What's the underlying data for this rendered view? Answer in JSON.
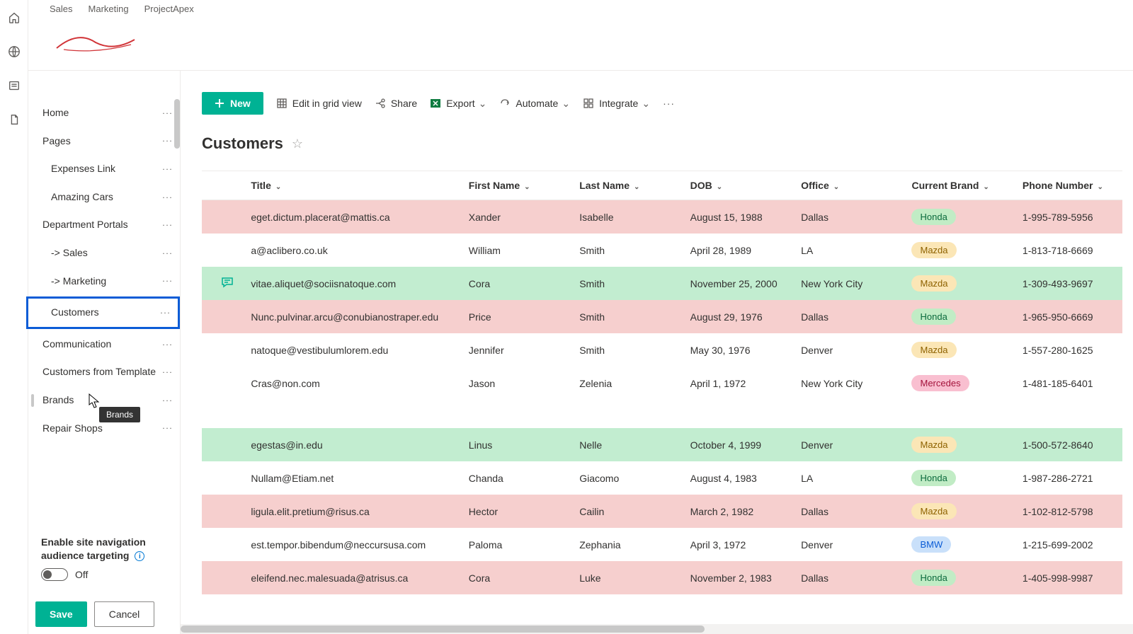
{
  "tabs": [
    "Sales",
    "Marketing",
    "ProjectApex"
  ],
  "sidebar": {
    "items": [
      {
        "label": "Home"
      },
      {
        "label": "Pages"
      },
      {
        "label": "Expenses Link"
      },
      {
        "label": "Amazing Cars"
      },
      {
        "label": "Department Portals"
      },
      {
        "label": "-> Sales"
      },
      {
        "label": "-> Marketing"
      },
      {
        "label": "Customers"
      },
      {
        "label": "Communication"
      },
      {
        "label": "Customers from Template"
      },
      {
        "label": "Brands"
      },
      {
        "label": "Repair Shops"
      }
    ],
    "tooltip": "Brands",
    "audience_targeting_title": "Enable site navigation audience targeting",
    "toggle_label": "Off",
    "save": "Save",
    "cancel": "Cancel"
  },
  "toolbar": {
    "new": "New",
    "edit": "Edit in grid view",
    "share": "Share",
    "export": "Export",
    "automate": "Automate",
    "integrate": "Integrate"
  },
  "page_title": "Customers",
  "columns": {
    "title": "Title",
    "first": "First Name",
    "last": "Last Name",
    "dob": "DOB",
    "office": "Office",
    "brand": "Current Brand",
    "phone": "Phone Number"
  },
  "rows": [
    {
      "color": "pink",
      "comment": false,
      "title": "eget.dictum.placerat@mattis.ca",
      "first": "Xander",
      "last": "Isabelle",
      "dob": "August 15, 1988",
      "office": "Dallas",
      "brand": "Honda",
      "badge": "honda",
      "phone": "1-995-789-5956"
    },
    {
      "color": "white",
      "comment": false,
      "title": "a@aclibero.co.uk",
      "first": "William",
      "last": "Smith",
      "dob": "April 28, 1989",
      "office": "LA",
      "brand": "Mazda",
      "badge": "mazda",
      "phone": "1-813-718-6669"
    },
    {
      "color": "green",
      "comment": true,
      "title": "vitae.aliquet@sociisnatoque.com",
      "first": "Cora",
      "last": "Smith",
      "dob": "November 25, 2000",
      "office": "New York City",
      "brand": "Mazda",
      "badge": "mazda",
      "phone": "1-309-493-9697"
    },
    {
      "color": "pink",
      "comment": false,
      "title": "Nunc.pulvinar.arcu@conubianostraper.edu",
      "first": "Price",
      "last": "Smith",
      "dob": "August 29, 1976",
      "office": "Dallas",
      "brand": "Honda",
      "badge": "honda",
      "phone": "1-965-950-6669"
    },
    {
      "color": "white",
      "comment": false,
      "title": "natoque@vestibulumlorem.edu",
      "first": "Jennifer",
      "last": "Smith",
      "dob": "May 30, 1976",
      "office": "Denver",
      "brand": "Mazda",
      "badge": "mazda",
      "phone": "1-557-280-1625"
    },
    {
      "color": "white",
      "comment": false,
      "title": "Cras@non.com",
      "first": "Jason",
      "last": "Zelenia",
      "dob": "April 1, 1972",
      "office": "New York City",
      "brand": "Mercedes",
      "badge": "mercedes",
      "phone": "1-481-185-6401"
    }
  ],
  "rows2": [
    {
      "color": "green",
      "comment": false,
      "title": "egestas@in.edu",
      "first": "Linus",
      "last": "Nelle",
      "dob": "October 4, 1999",
      "office": "Denver",
      "brand": "Mazda",
      "badge": "mazda",
      "phone": "1-500-572-8640"
    },
    {
      "color": "white",
      "comment": false,
      "title": "Nullam@Etiam.net",
      "first": "Chanda",
      "last": "Giacomo",
      "dob": "August 4, 1983",
      "office": "LA",
      "brand": "Honda",
      "badge": "honda",
      "phone": "1-987-286-2721"
    },
    {
      "color": "pink",
      "comment": false,
      "title": "ligula.elit.pretium@risus.ca",
      "first": "Hector",
      "last": "Cailin",
      "dob": "March 2, 1982",
      "office": "Dallas",
      "brand": "Mazda",
      "badge": "mazda",
      "phone": "1-102-812-5798"
    },
    {
      "color": "white",
      "comment": false,
      "title": "est.tempor.bibendum@neccursusa.com",
      "first": "Paloma",
      "last": "Zephania",
      "dob": "April 3, 1972",
      "office": "Denver",
      "brand": "BMW",
      "badge": "bmw",
      "phone": "1-215-699-2002"
    },
    {
      "color": "pink",
      "comment": false,
      "title": "eleifend.nec.malesuada@atrisus.ca",
      "first": "Cora",
      "last": "Luke",
      "dob": "November 2, 1983",
      "office": "Dallas",
      "brand": "Honda",
      "badge": "honda",
      "phone": "1-405-998-9987"
    }
  ]
}
